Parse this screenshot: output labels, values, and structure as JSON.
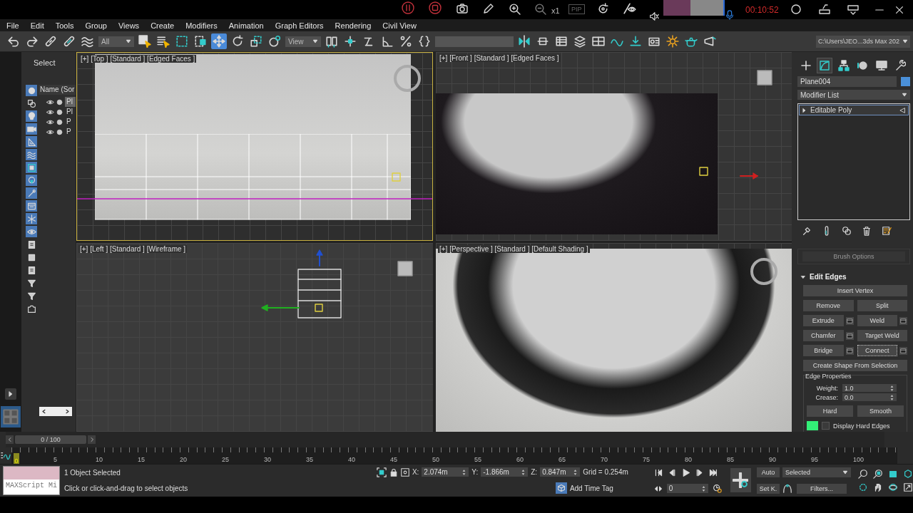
{
  "recorder": {
    "zoom": "x1",
    "pip": "PIP",
    "timer": "00:10:52"
  },
  "menu": [
    "File",
    "Edit",
    "Tools",
    "Group",
    "Views",
    "Create",
    "Modifiers",
    "Animation",
    "Graph Editors",
    "Rendering",
    "Civil View"
  ],
  "toolbar": {
    "tools": [
      {
        "kind": "undo",
        "selected": false
      },
      {
        "kind": "redo",
        "selected": false
      },
      {
        "kind": "link",
        "selected": false
      },
      {
        "kind": "unlink",
        "selected": false
      },
      {
        "kind": "wave",
        "selected": false
      },
      {
        "kind": "dropdown",
        "label": "All"
      },
      {
        "kind": "select",
        "selected": false
      },
      {
        "kind": "list-select",
        "selected": false
      },
      {
        "kind": "rectangle-select",
        "selected": false
      },
      {
        "kind": "window-select",
        "selected": false
      },
      {
        "kind": "move",
        "selected": true
      },
      {
        "kind": "rotate",
        "selected": false
      },
      {
        "kind": "scale",
        "selected": false
      },
      {
        "kind": "placement",
        "selected": false
      },
      {
        "kind": "dropdown",
        "label": "View"
      },
      {
        "kind": "pivot",
        "selected": false
      },
      {
        "kind": "axis",
        "selected": false
      },
      {
        "kind": "snap",
        "selected": false
      },
      {
        "kind": "angle-snap",
        "selected": false
      },
      {
        "kind": "percent-snap",
        "selected": false
      },
      {
        "kind": "braces",
        "selected": false
      },
      {
        "kind": "field"
      },
      {
        "kind": "mirror",
        "selected": false
      },
      {
        "kind": "align",
        "selected": false
      },
      {
        "kind": "list",
        "selected": false
      },
      {
        "kind": "layers",
        "selected": false
      },
      {
        "kind": "grid",
        "selected": false
      },
      {
        "kind": "curve",
        "selected": false
      },
      {
        "kind": "download",
        "selected": false
      },
      {
        "kind": "render-setup",
        "selected": false
      },
      {
        "kind": "gear",
        "selected": false
      },
      {
        "kind": "teapot",
        "selected": false
      },
      {
        "kind": "render",
        "selected": false
      }
    ],
    "project_path": "C:\\Users\\JEO...3ds Max 202"
  },
  "scene_explorer": {
    "title": "Select",
    "column": "Name (Sor",
    "tools": [
      {
        "kind": "circle",
        "on": true
      },
      {
        "kind": "shapes",
        "on": false
      },
      {
        "kind": "bulb",
        "on": true
      },
      {
        "kind": "camera",
        "on": true
      },
      {
        "kind": "triangle",
        "on": true
      },
      {
        "kind": "wave",
        "on": true
      },
      {
        "kind": "group",
        "on": true
      },
      {
        "kind": "globe",
        "on": true
      },
      {
        "kind": "bone",
        "on": true
      },
      {
        "kind": "box",
        "on": true
      },
      {
        "kind": "snowflake",
        "on": true
      },
      {
        "kind": "eye",
        "on": true
      },
      {
        "kind": "page",
        "on": false
      },
      {
        "kind": "square",
        "on": false
      },
      {
        "kind": "page",
        "on": false
      },
      {
        "kind": "funnel",
        "on": false
      },
      {
        "kind": "funnel",
        "on": false
      },
      {
        "kind": "frame",
        "on": false
      }
    ],
    "rows": [
      {
        "name": "Pl",
        "selected": true
      },
      {
        "name": "Pl",
        "selected": false
      },
      {
        "name": "P",
        "selected": false
      },
      {
        "name": "P",
        "selected": false
      }
    ]
  },
  "viewports": [
    {
      "kind": "top",
      "label": "[+] [Top ] [Standard ] [Edged Faces ]",
      "active": true
    },
    {
      "kind": "front",
      "label": "[+] [Front ] [Standard ] [Edged Faces ]",
      "active": false
    },
    {
      "kind": "left",
      "label": "[+] [Left ] [Standard ] [Wireframe ]",
      "active": false
    },
    {
      "kind": "perspective",
      "label": "[+] [Perspective ] [Standard ] [Default Shading ]",
      "active": false
    }
  ],
  "command_panel": {
    "tabs": [
      {
        "kind": "create",
        "selected": false
      },
      {
        "kind": "modify",
        "selected": true
      },
      {
        "kind": "hierarchy",
        "selected": false
      },
      {
        "kind": "motion",
        "selected": false
      },
      {
        "kind": "display",
        "selected": false
      },
      {
        "kind": "utilities",
        "selected": false
      }
    ],
    "object": {
      "name": "Plane004"
    },
    "modifier_list": "Modifier List",
    "stack": [
      {
        "name": "Editable Poly",
        "selected": true
      }
    ],
    "brush_options": {
      "label": "Brush Options",
      "disabled": true
    },
    "rollout": {
      "title": "Edit Edges",
      "expanded": true,
      "rows": [
        [
          {
            "label": "Insert Vertex",
            "settings": false,
            "focused": false
          }
        ],
        [
          {
            "label": "Remove",
            "settings": false,
            "focused": false
          },
          {
            "label": "Split",
            "settings": false,
            "focused": false
          }
        ],
        [
          {
            "label": "Extrude",
            "settings": true,
            "focused": false
          },
          {
            "label": "Weld",
            "settings": true,
            "focused": false
          }
        ],
        [
          {
            "label": "Chamfer",
            "settings": true,
            "focused": false
          },
          {
            "label": "Target Weld",
            "settings": false,
            "focused": false
          }
        ],
        [
          {
            "label": "Bridge",
            "settings": true,
            "focused": false
          },
          {
            "label": "Connect",
            "settings": true,
            "focused": true
          }
        ],
        [
          {
            "label": "Create Shape From Selection",
            "settings": false,
            "focused": false
          }
        ]
      ],
      "edge_properties": {
        "title": "Edge Properties",
        "weight_label": "Weight:",
        "weight": "1.0",
        "crease_label": "Crease:",
        "crease": "0.0",
        "hard": "Hard",
        "smooth": "Smooth",
        "display_hard_edges": {
          "label": "Display Hard Edges",
          "checked": false
        }
      }
    }
  },
  "timeline": {
    "frame": "0 / 100",
    "level": 0,
    "current": "0",
    "ticks": [
      "5",
      "10",
      "15",
      "20",
      "25",
      "30",
      "35",
      "40",
      "45",
      "50",
      "55",
      "60",
      "65",
      "70",
      "75",
      "80",
      "85",
      "90",
      "95",
      "100"
    ]
  },
  "status_bar": {
    "maxscript": "MAXScript Mi",
    "selection": "1 Object Selected",
    "prompt": "Click or click-and-drag to select objects",
    "x_label": "X:",
    "x": "2.074m",
    "y_label": "Y:",
    "y": "-1.866m",
    "z_label": "Z:",
    "z": "0.847m",
    "grid": "Grid = 0.254m",
    "add_time_tag": "Add Time Tag",
    "frame": "0",
    "auto": "Auto",
    "set_key": "Set K.",
    "key_filter": "Selected",
    "filters": "Filters..."
  }
}
